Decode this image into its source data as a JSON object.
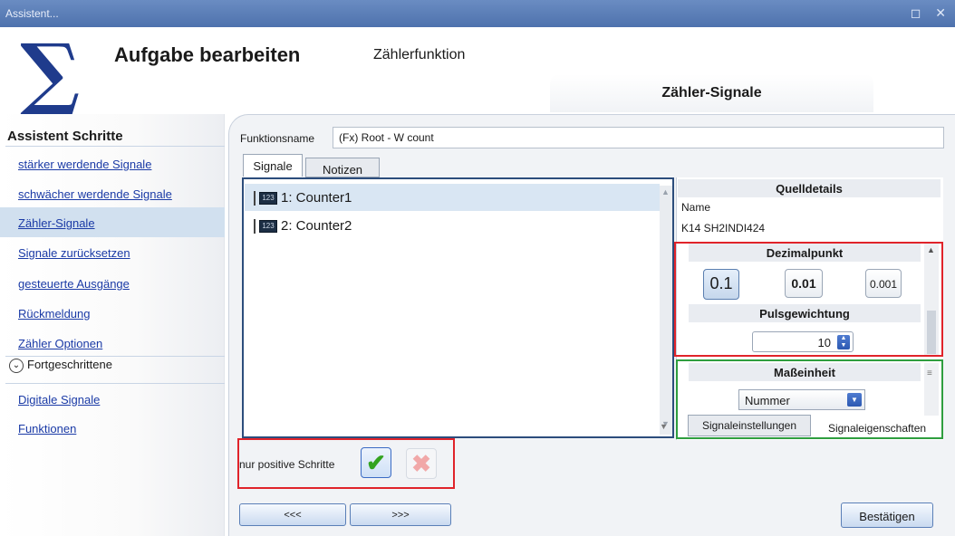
{
  "window": {
    "title": "Assistent...",
    "controls": "◻ ✕"
  },
  "header": {
    "logo_symbol": "∑",
    "title": "Aufgabe bearbeiten",
    "subtitle": "Zählerfunktion",
    "tab": "Zähler-Signale"
  },
  "sidebar": {
    "title": "Assistent Schritte",
    "items": [
      {
        "label": "stärker werdende Signale"
      },
      {
        "label": "schwächer werdende Signale"
      },
      {
        "label": "Zähler-Signale",
        "active": true
      },
      {
        "label": "Signale zurücksetzen"
      },
      {
        "label": "gesteuerte Ausgänge"
      },
      {
        "label": "Rückmeldung"
      },
      {
        "label": "Zähler Optionen"
      }
    ],
    "advanced": {
      "label": "Fortgeschrittene"
    },
    "advanced_items": [
      {
        "label": "Digitale Signale"
      },
      {
        "label": "Funktionen"
      }
    ]
  },
  "main": {
    "function_name_label": "Funktionsname",
    "function_name_value": "(Fx) Root - W count",
    "tabs": [
      {
        "label": "Signale",
        "active": true
      },
      {
        "label": "Notizen"
      }
    ],
    "signals": [
      {
        "icon": "123",
        "label": "1: Counter1",
        "selected": true
      },
      {
        "icon": "123",
        "label": "2: Counter2"
      }
    ]
  },
  "details": {
    "header": "Quelldetails",
    "name_label": "Name",
    "name_value": "K14 SH2INDI424",
    "decimal": {
      "header": "Dezimalpunkt",
      "options": [
        "0.1",
        "0.01",
        "0.001"
      ],
      "selected": "0.1"
    },
    "pulse_weight": {
      "header": "Pulsgewichtung",
      "value": "10"
    },
    "unit": {
      "header": "Maßeinheit",
      "selected": "Nummer"
    },
    "tabs": [
      "Signaleinstellungen",
      "Signaleigenschaften"
    ]
  },
  "positive_steps": {
    "label": "nur positive Schritte",
    "enabled": true
  },
  "footer": {
    "prev": "<<<",
    "next": ">>>",
    "confirm": "Bestätigen"
  },
  "colors": {
    "accent": "#1f3b8c",
    "highlight_red": "#e0232a",
    "highlight_green": "#2f9e3f",
    "selection": "#d1e0ef"
  }
}
